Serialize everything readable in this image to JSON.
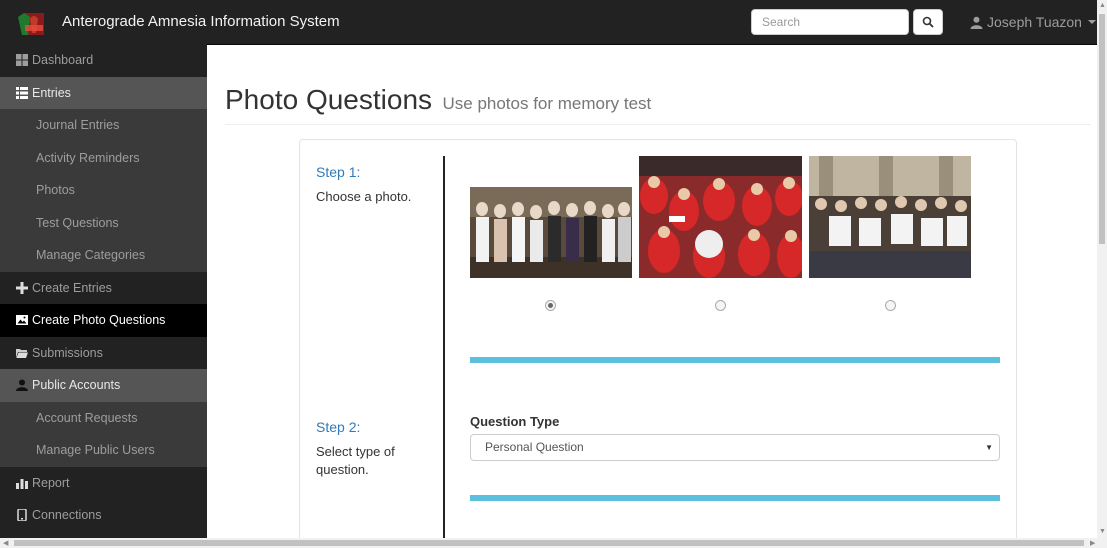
{
  "navbar": {
    "title": "Anterograde Amnesia Information System",
    "search_placeholder": "Search",
    "user_name": "Joseph Tuazon"
  },
  "sidebar": {
    "items": [
      {
        "label": "Dashboard",
        "icon": "dashboard-icon"
      },
      {
        "label": "Entries",
        "icon": "list-icon"
      },
      {
        "label": "Journal Entries"
      },
      {
        "label": "Activity Reminders"
      },
      {
        "label": "Photos"
      },
      {
        "label": "Test Questions"
      },
      {
        "label": "Manage Categories"
      },
      {
        "label": "Create Entries",
        "icon": "plus-icon"
      },
      {
        "label": "Create Photo Questions",
        "icon": "picture-icon"
      },
      {
        "label": "Submissions",
        "icon": "folder-icon"
      },
      {
        "label": "Public Accounts",
        "icon": "user-icon"
      },
      {
        "label": "Account Requests"
      },
      {
        "label": "Manage Public Users"
      },
      {
        "label": "Report",
        "icon": "bar-chart-icon"
      },
      {
        "label": "Connections",
        "icon": "phone-icon"
      }
    ]
  },
  "main": {
    "title": "Photo Questions",
    "subtitle": "Use photos for memory test",
    "step1": {
      "title": "Step 1:",
      "desc": "Choose a photo."
    },
    "step2": {
      "title": "Step 2:",
      "desc": "Select type of question."
    },
    "photos": [
      {
        "alt": "group-photo-1",
        "selected": true
      },
      {
        "alt": "group-photo-2",
        "selected": false
      },
      {
        "alt": "group-photo-3",
        "selected": false
      }
    ],
    "question_type_label": "Question Type",
    "question_type_value": "Personal Question"
  },
  "colors": {
    "navbar_bg": "#222222",
    "accent_link": "#337ab7",
    "progress_bar": "#5bc0de",
    "active_item_bg": "#000000"
  }
}
